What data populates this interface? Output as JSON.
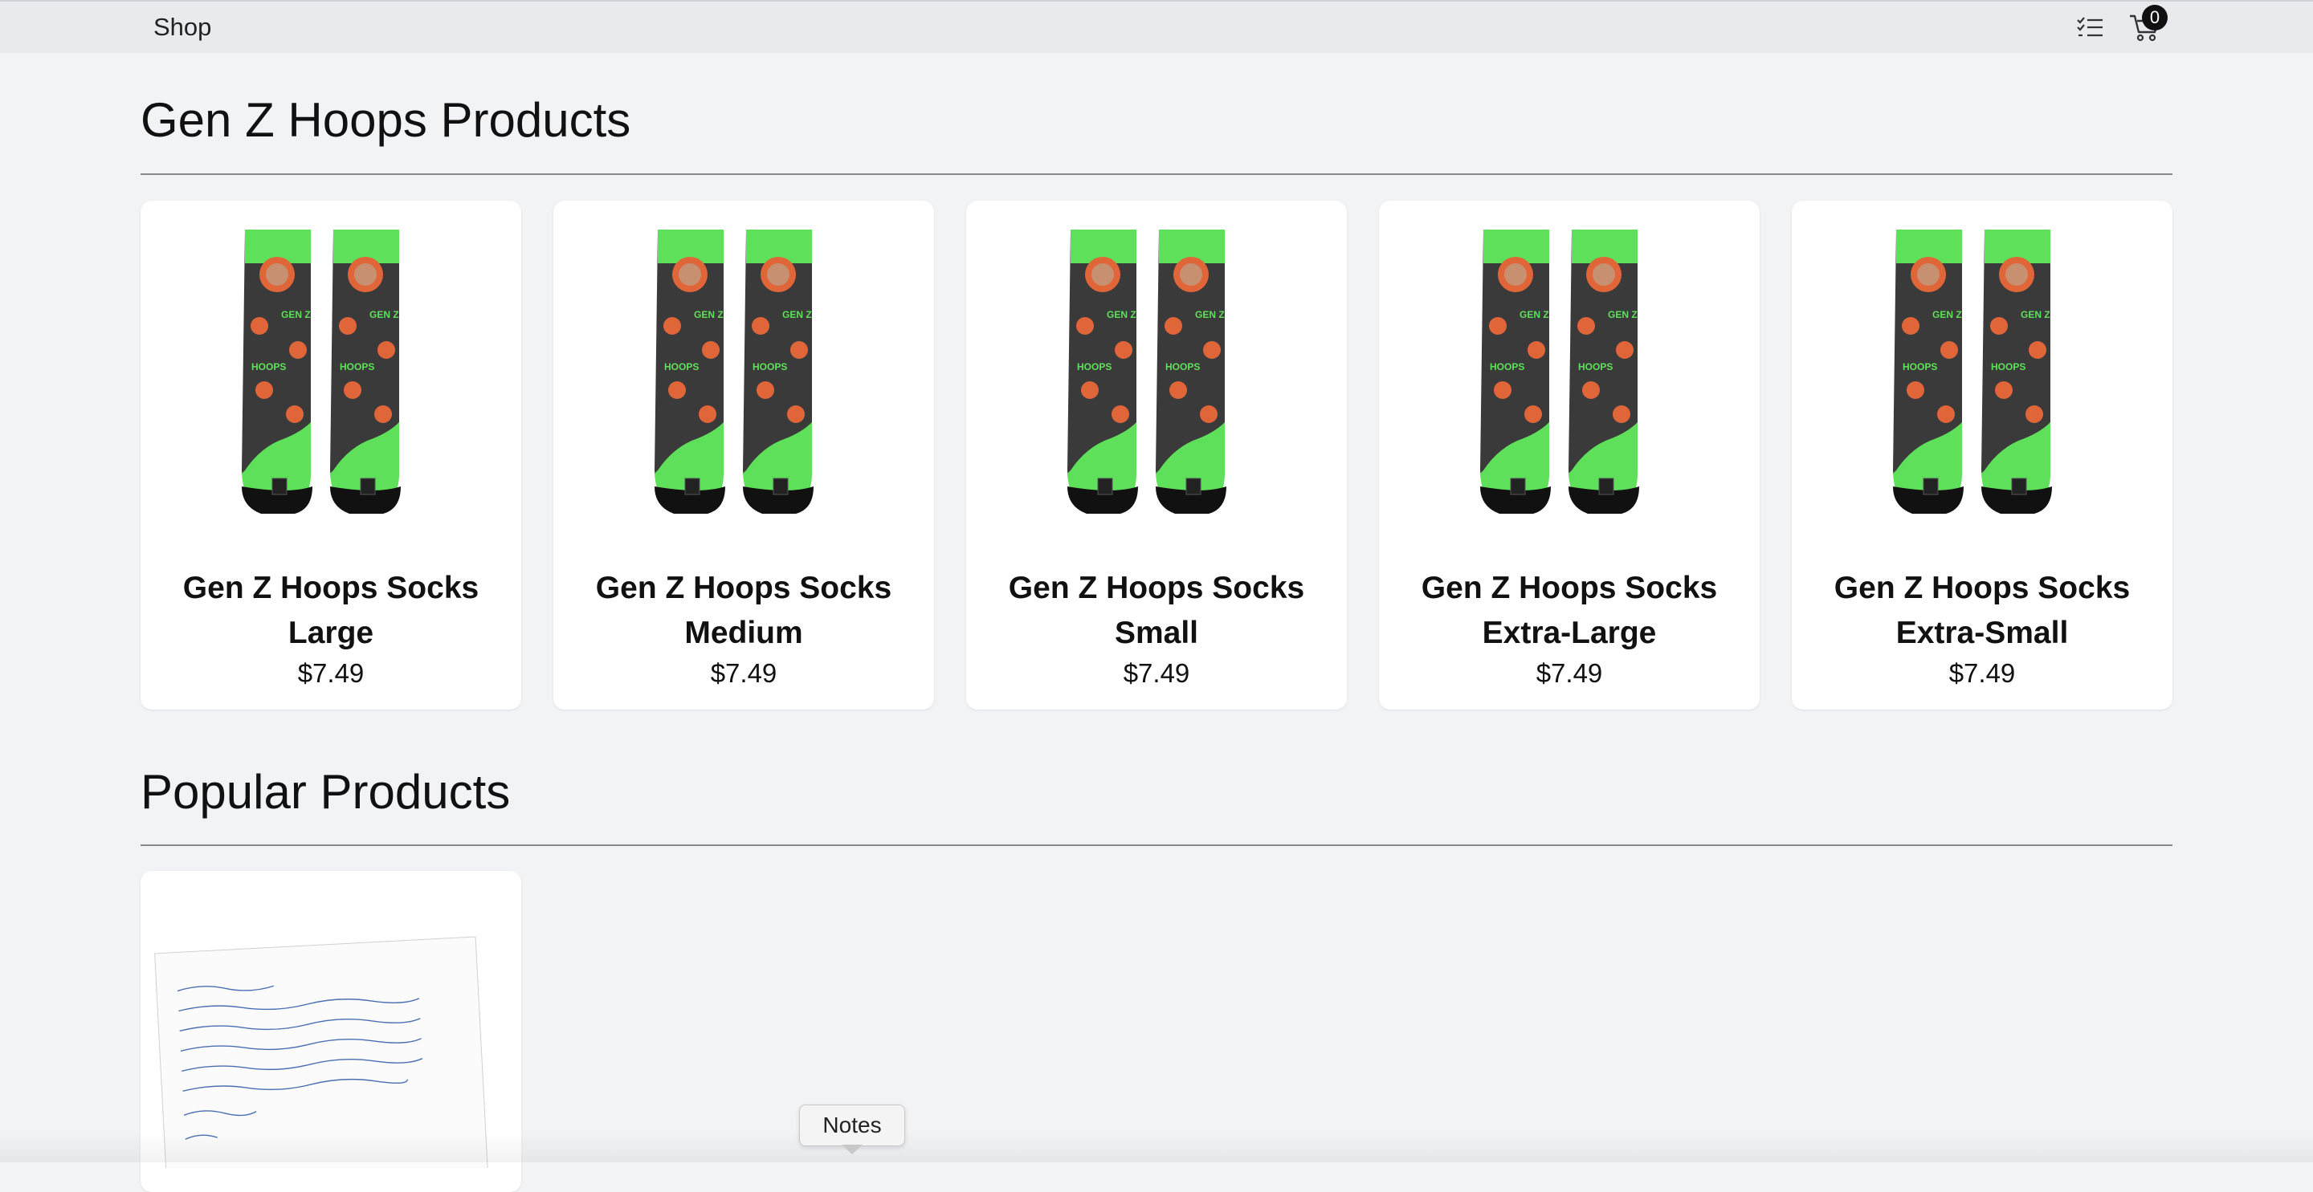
{
  "nav": {
    "brand": "Shop",
    "cart_count": "0",
    "list_icon": "checklist-icon",
    "cart_icon": "shopping-cart-icon"
  },
  "sections": {
    "gen_z": {
      "title": "Gen Z Hoops Products"
    },
    "popular": {
      "title": "Popular Products"
    }
  },
  "products": [
    {
      "name_line1": "Gen Z Hoops Socks",
      "name_line2": "Large",
      "price": "$7.49"
    },
    {
      "name_line1": "Gen Z Hoops Socks",
      "name_line2": "Medium",
      "price": "$7.49"
    },
    {
      "name_line1": "Gen Z Hoops Socks",
      "name_line2": "Small",
      "price": "$7.49"
    },
    {
      "name_line1": "Gen Z Hoops Socks",
      "name_line2": "Extra-Large",
      "price": "$7.49"
    },
    {
      "name_line1": "Gen Z Hoops Socks",
      "name_line2": "Extra-Small",
      "price": "$7.49"
    }
  ],
  "popular_products": [
    {
      "image": "handwritten-note-card"
    }
  ],
  "tooltip": {
    "label": "Notes"
  },
  "colors": {
    "sock_green": "#5fe05a",
    "sock_dark": "#3a3a3a",
    "face_orange": "#e0663a",
    "page_bg": "#f2f3f5"
  }
}
